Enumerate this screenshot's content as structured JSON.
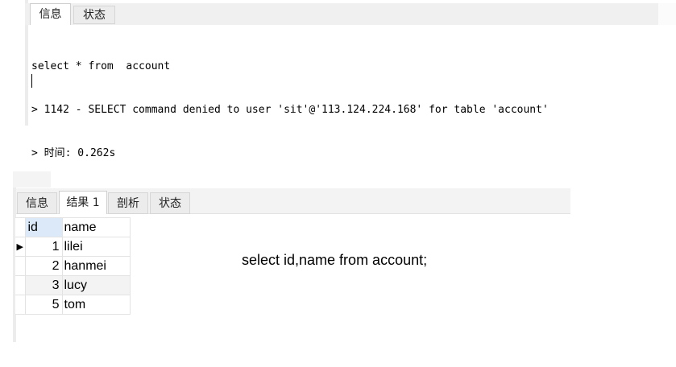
{
  "top_panel": {
    "tabs": [
      {
        "label": "信息",
        "active": true
      },
      {
        "label": "状态",
        "active": false
      }
    ],
    "lines": [
      "select * from  account",
      "> 1142 - SELECT command denied to user 'sit'@'113.124.224.168' for table 'account'",
      "> 时间: 0.262s"
    ]
  },
  "bottom_panel": {
    "tabs": [
      {
        "label": "信息",
        "active": false
      },
      {
        "label": "结果 1",
        "active": true
      },
      {
        "label": "剖析",
        "active": false
      },
      {
        "label": "状态",
        "active": false
      }
    ],
    "columns": [
      "id",
      "name"
    ],
    "current_row_indicator": "▶",
    "rows": [
      {
        "id": "1",
        "name": "lilei"
      },
      {
        "id": "2",
        "name": "hanmei"
      },
      {
        "id": "3",
        "name": "lucy"
      },
      {
        "id": "5",
        "name": "tom"
      }
    ]
  },
  "annotation": "select id,name from  account;",
  "colors": {
    "header_selected": "#dce9f8",
    "row_alt": "#f3f3f3",
    "tab_bar": "#f0f0f0"
  }
}
